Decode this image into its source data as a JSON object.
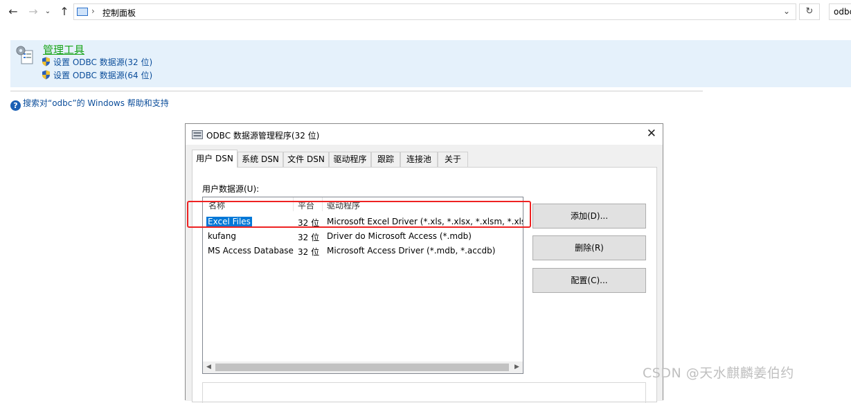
{
  "address_bar": {
    "breadcrumb": "控制面板",
    "search_value": "odbc"
  },
  "results": {
    "group_title": "管理工具",
    "links": [
      "设置 ODBC 数据源(32 位)",
      "设置 ODBC 数据源(64 位)"
    ]
  },
  "help": {
    "text": "搜索对“odbc”的 Windows 帮助和支持"
  },
  "dialog": {
    "title": "ODBC 数据源管理程序(32 位)",
    "tabs": [
      "用户 DSN",
      "系统 DSN",
      "文件 DSN",
      "驱动程序",
      "跟踪",
      "连接池",
      "关于"
    ],
    "active_tab": "用户 DSN",
    "list_label": "用户数据源(U):",
    "columns": [
      "名称",
      "平台",
      "驱动程序"
    ],
    "rows": [
      {
        "name": "Excel Files",
        "platform": "32 位",
        "driver": "Microsoft Excel Driver (*.xls, *.xlsx, *.xlsm, *.xlsb)",
        "selected": true
      },
      {
        "name": "kufang",
        "platform": "32 位",
        "driver": "Driver do Microsoft Access (*.mdb)",
        "selected": false
      },
      {
        "name": "MS Access Database",
        "platform": "32 位",
        "driver": "Microsoft Access Driver (*.mdb, *.accdb)",
        "selected": false
      }
    ],
    "buttons": {
      "add": "添加(D)...",
      "remove": "删除(R)",
      "configure": "配置(C)..."
    }
  },
  "watermark": "CSDN @天水麒麟姜伯约",
  "colors": {
    "selection": "#0078d7",
    "highlight_box": "#ee2222",
    "result_bg": "#e5f1fb",
    "group_title": "#16a316",
    "link": "#0b4d9a"
  }
}
